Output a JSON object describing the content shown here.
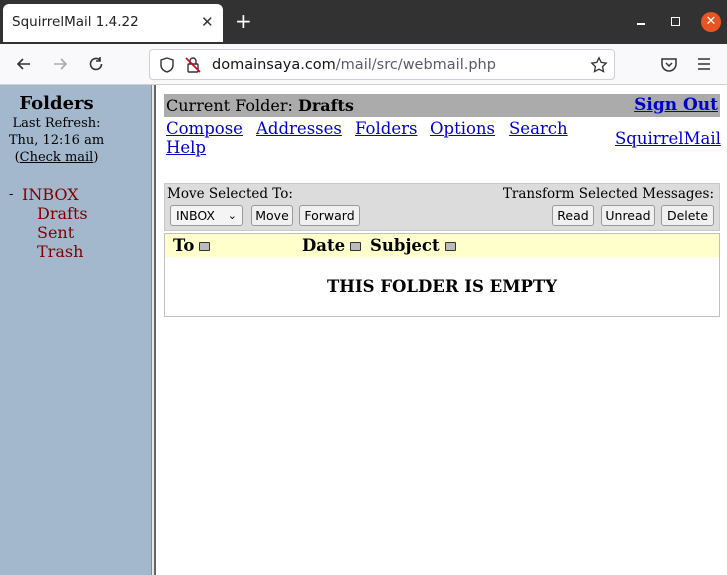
{
  "browser": {
    "tab_title": "SquirrelMail 1.4.22",
    "url_domain": "domainsaya.com",
    "url_path": "/mail/src/webmail.php"
  },
  "sidebar": {
    "heading": "Folders",
    "last_refresh_label": "Last Refresh:",
    "last_refresh_time": "Thu, 12:16 am",
    "check_mail_open": "(",
    "check_mail_link": "Check mail",
    "check_mail_close": ")",
    "folders": [
      {
        "name": "INBOX",
        "prefix": "-"
      },
      {
        "name": "Drafts"
      },
      {
        "name": "Sent"
      },
      {
        "name": "Trash"
      }
    ]
  },
  "header": {
    "current_folder_label": "Current Folder:",
    "current_folder_name": "Drafts",
    "sign_out": "Sign Out",
    "squirrelmail_link": "SquirrelMail",
    "menu": [
      "Compose",
      "Addresses",
      "Folders",
      "Options",
      "Search",
      "Help"
    ]
  },
  "actions": {
    "move_label": "Move Selected To:",
    "transform_label": "Transform Selected Messages:",
    "move_target": "INBOX",
    "move_button": "Move",
    "forward_button": "Forward",
    "read_button": "Read",
    "unread_button": "Unread",
    "delete_button": "Delete"
  },
  "table": {
    "columns": [
      "To",
      "Date",
      "Subject"
    ],
    "empty_message": "THIS FOLDER IS EMPTY"
  },
  "colors": {
    "sidebar_bg": "#a3b8cc",
    "folder_link": "#800000",
    "link": "#0000cc",
    "header_row": "#ffffcc",
    "title_bar": "#ababab"
  }
}
